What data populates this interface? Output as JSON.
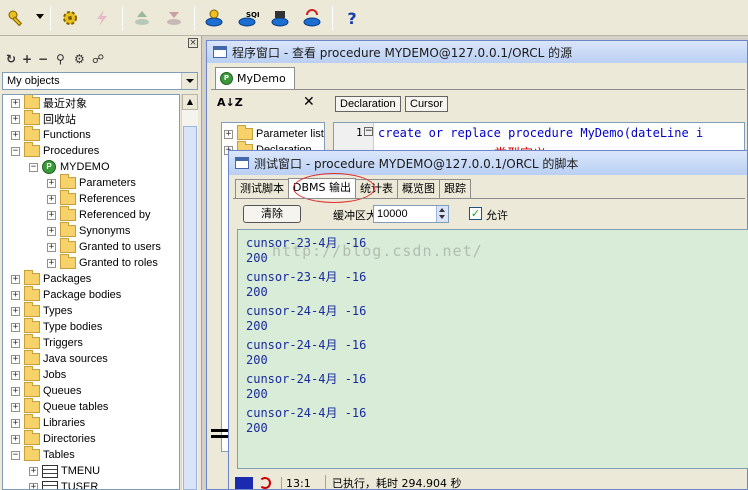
{
  "toolbar": {
    "icons": [
      "key-icon",
      "gear-icon",
      "lightning-icon",
      "db-up-icon",
      "db-down-icon",
      "db-connect-icon",
      "sql-icon",
      "db-cmd-icon",
      "db-refresh-icon",
      "help-icon"
    ],
    "help_label": "?",
    "sql_label": "SQL"
  },
  "object_browser": {
    "selector_value": "My objects",
    "tree": [
      {
        "label": "最近对象",
        "expanded": false
      },
      {
        "label": "回收站",
        "expanded": false
      },
      {
        "label": "Functions",
        "expanded": false
      },
      {
        "label": "Procedures",
        "expanded": true
      },
      {
        "label": "MYDEMO",
        "expanded": true,
        "kind": "procedure"
      },
      {
        "label": "Parameters"
      },
      {
        "label": "References"
      },
      {
        "label": "Referenced by"
      },
      {
        "label": "Synonyms"
      },
      {
        "label": "Granted to users"
      },
      {
        "label": "Granted to roles"
      },
      {
        "label": "Packages"
      },
      {
        "label": "Package bodies"
      },
      {
        "label": "Types"
      },
      {
        "label": "Type bodies"
      },
      {
        "label": "Triggers"
      },
      {
        "label": "Java sources"
      },
      {
        "label": "Jobs"
      },
      {
        "label": "Queues"
      },
      {
        "label": "Queue tables"
      },
      {
        "label": "Libraries"
      },
      {
        "label": "Directories"
      },
      {
        "label": "Tables",
        "expanded": true
      },
      {
        "label": "TMENU",
        "kind": "table"
      },
      {
        "label": "TUSER",
        "kind": "table"
      }
    ]
  },
  "program_window": {
    "title": "程序窗口 - 查看 procedure MYDEMO@127.0.0.1/ORCL 的源",
    "tab": "MyDemo",
    "sort_label": "A↓Z",
    "declaration_btn": "Declaration",
    "cursor_btn": "Cursor",
    "outline": [
      "Parameter list",
      "Declaration"
    ],
    "line_number": "1",
    "code_keyword1": "create",
    "code_keyword2": "or",
    "code_keyword3": "replace",
    "code_keyword4": "procedure",
    "code_name": "MyDemo(dateLine i",
    "code_comment": "类型定义"
  },
  "test_window": {
    "title": "测试窗口 - procedure MYDEMO@127.0.0.1/ORCL 的脚本",
    "tabs": [
      "测试脚本",
      "DBMS 输出",
      "统计表",
      "概览图",
      "跟踪"
    ],
    "active_tab": 1,
    "clear_btn": "清除",
    "buffer_label": "缓冲区大小",
    "buffer_value": "10000",
    "allow_label": "允许",
    "allow_checked": "✓",
    "watermark": "http://blog.csdn.net/",
    "output_lines": [
      "cunsor-23-4月 -16",
      "200",
      "cunsor-23-4月 -16",
      "200",
      "cunsor-24-4月 -16",
      "200",
      "cunsor-24-4月 -16",
      "200",
      "cunsor-24-4月 -16",
      "200",
      "cunsor-24-4月 -16",
      "200"
    ],
    "status_pos": "13:1",
    "status_msg": "已执行，耗时 294.904 秒"
  }
}
